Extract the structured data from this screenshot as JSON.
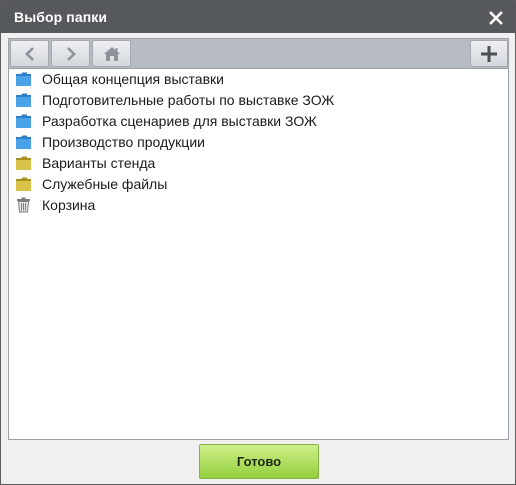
{
  "dialog": {
    "title": "Выбор папки",
    "close_icon": "close-icon"
  },
  "toolbar": {
    "back_icon": "chevron-left-icon",
    "forward_icon": "chevron-right-icon",
    "home_icon": "home-icon",
    "add_icon": "plus-icon"
  },
  "folders": [
    {
      "label": "Общая концепция выставки",
      "icon": "folder-blue-icon",
      "color": "#3b8fd6"
    },
    {
      "label": "Подготовительные работы по выставке ЗОЖ",
      "icon": "folder-blue-icon",
      "color": "#3b8fd6"
    },
    {
      "label": "Разработка сценариев для выставки ЗОЖ",
      "icon": "folder-blue-icon",
      "color": "#3b8fd6"
    },
    {
      "label": "Производство продукции",
      "icon": "folder-blue-icon",
      "color": "#3b8fd6"
    },
    {
      "label": "Варианты стенда",
      "icon": "folder-yellow-icon",
      "color": "#c9b43a"
    },
    {
      "label": "Служебные файлы",
      "icon": "folder-yellow-icon",
      "color": "#c9b43a"
    },
    {
      "label": "Корзина",
      "icon": "trash-icon",
      "color": "#8a8a8a"
    }
  ],
  "footer": {
    "done_label": "Готово"
  },
  "colors": {
    "titlebar": "#56595c",
    "toolbar": "#b7bcc3",
    "done_button": "#93cf3d"
  }
}
